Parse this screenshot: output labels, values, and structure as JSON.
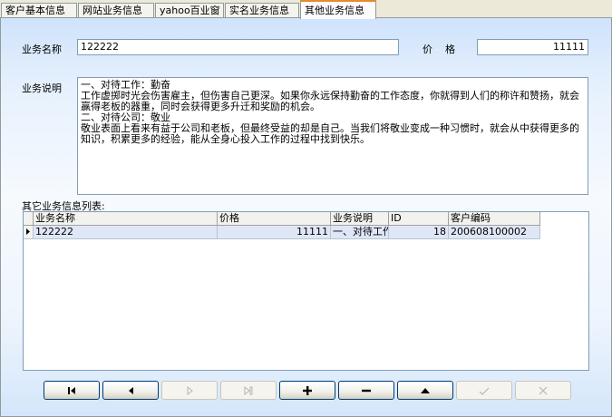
{
  "tabs": [
    {
      "label": "客户基本信息",
      "active": false
    },
    {
      "label": "网站业务信息",
      "active": false
    },
    {
      "label": "yahoo百业窗",
      "active": false
    },
    {
      "label": "实名业务信息",
      "active": false
    },
    {
      "label": "其他业务信息",
      "active": true
    }
  ],
  "form": {
    "name_label": "业务名称",
    "name_value": "122222",
    "price_label": "价    格",
    "price_value": "11111",
    "desc_label": "业务说明",
    "desc_value": "一、对待工作：勤奋\n工作虚掷时光会伤害雇主，但伤害自己更深。如果你永远保持勤奋的工作态度，你就得到人们的称许和赞扬，就会赢得老板的器重，同时会获得更多升迁和奖励的机会。\n二、对待公司：敬业\n敬业表面上看来有益于公司和老板，但最终受益的却是自己。当我们将敬业变成一种习惯时，就会从中获得更多的知识，积累更多的经验，能从全身心投入工作的过程中找到快乐。"
  },
  "list": {
    "title": "其它业务信息列表:",
    "columns": [
      "业务名称",
      "价格",
      "业务说明",
      "ID",
      "客户编码"
    ],
    "rows": [
      {
        "name": "122222",
        "price": "11111",
        "desc": "一、对待工作",
        "id": "18",
        "code": "200608100002"
      }
    ]
  },
  "navigator": {
    "buttons": [
      {
        "icon": "first-record-icon",
        "enabled": true
      },
      {
        "icon": "prior-record-icon",
        "enabled": true
      },
      {
        "icon": "next-record-icon",
        "enabled": false
      },
      {
        "icon": "last-record-icon",
        "enabled": false
      },
      {
        "icon": "insert-icon",
        "enabled": true
      },
      {
        "icon": "delete-icon",
        "enabled": true
      },
      {
        "icon": "edit-icon",
        "enabled": true
      },
      {
        "icon": "post-icon",
        "enabled": false
      },
      {
        "icon": "cancel-icon",
        "enabled": false
      }
    ]
  }
}
